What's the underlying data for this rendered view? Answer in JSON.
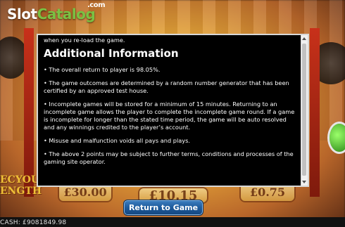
{
  "brand": {
    "logo_main": "Slot",
    "logo_accent": "Catalog",
    "logo_suffix": ".com"
  },
  "dialog": {
    "lead_text": "when you re-load the game.",
    "heading": "Additional Information",
    "bullets": [
      "• The overall return to player is 98.05%.",
      "• The game outcomes are determined by a random number generator that has been certified by an approved test house.",
      "• Incomplete games will be stored for a minimum of 15 minutes. Returning to an incomplete game allows the player to complete the incomplete game round. If a game is incomplete for longer than the stated time period, the game will be auto resolved and any winnings credited to the player’s account.",
      "• Misuse and malfunction voids all pays and plays.",
      "• The above 2 points may be subject to further terms, conditions and processes of the gaming site operator."
    ]
  },
  "return_button": {
    "label": "Return to Game"
  },
  "background": {
    "tile_values": [
      "£30.00",
      "£10.15",
      "£0.75"
    ],
    "promo_line1": "ECYOU",
    "promo_line2": "ENGTH",
    "credit_text": "CASH: £9081849.98"
  },
  "colors": {
    "dialog_bg": "#000000",
    "button_blue": "#1d5a9b",
    "logo_green": "#7ac143"
  }
}
